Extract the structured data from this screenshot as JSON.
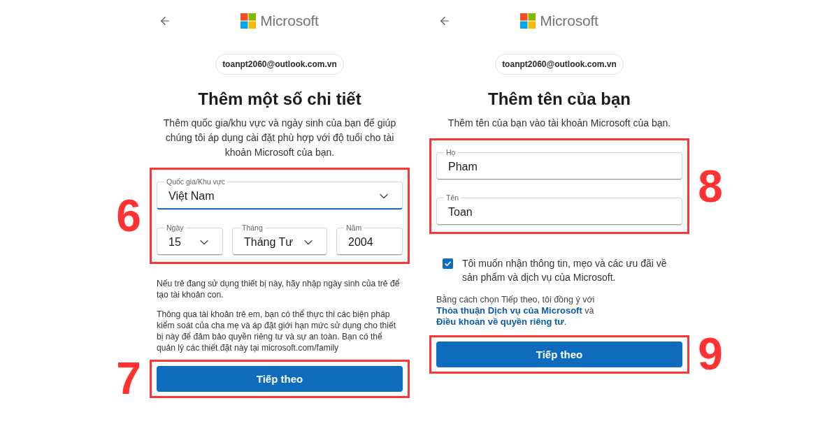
{
  "screens": [
    {
      "brand": "Microsoft",
      "account": "toanpt2060@outlook.com.vn",
      "title": "Thêm một số chi tiết",
      "description": "Thêm quốc gia/khu vực và ngày sinh của bạn để giúp chúng tôi áp dụng cài đặt phù hợp với độ tuổi cho tài khoản Microsoft của bạn.",
      "blocks": [
        {
          "kind": "fields",
          "step": "6",
          "rows": [
            [
              {
                "kind": "select",
                "label": "Quốc gia/Khu vực",
                "value": "Việt Nam",
                "focused": true
              }
            ],
            [
              {
                "kind": "select",
                "label": "Ngày",
                "value": "15",
                "focused": false
              },
              {
                "kind": "select",
                "label": "Tháng",
                "value": "Tháng Tư",
                "focused": false
              },
              {
                "kind": "text",
                "label": "Năm",
                "value": "2004",
                "focused": false
              }
            ]
          ]
        },
        {
          "kind": "paragraph",
          "text": "Nếu trẻ đang sử dụng thiết bị này, hãy nhập ngày sinh của trẻ để tạo tài khoản con."
        },
        {
          "kind": "paragraph",
          "text": "Thông qua tài khoản trẻ em, bạn có thể thực thi các biện pháp kiểm soát của cha mẹ và áp đặt giới hạn mức sử dụng cho thiết bị này để đảm bảo quyền riêng tư và sự an toàn. Bạn có thể quản lý các thiết đặt này tại microsoft.com/family"
        },
        {
          "kind": "button",
          "label": "Tiếp theo",
          "step": "7"
        }
      ]
    },
    {
      "brand": "Microsoft",
      "account": "toanpt2060@outlook.com.vn",
      "title": "Thêm tên của bạn",
      "description": "Thêm tên của bạn vào tài khoản Microsoft của bạn.",
      "blocks": [
        {
          "kind": "fields",
          "step": "8",
          "rows": [
            [
              {
                "kind": "text",
                "label": "Họ",
                "value": "Pham",
                "focused": false
              }
            ],
            [
              {
                "kind": "text",
                "label": "Tên",
                "value": "Toan",
                "focused": false
              }
            ]
          ]
        },
        {
          "kind": "checkbox",
          "checked": true,
          "text": "Tôi muốn nhận thông tin, mẹo và các ưu đãi về sản phẩm và dịch vụ của Microsoft."
        },
        {
          "kind": "legal",
          "parts": [
            {
              "kind": "text",
              "text": "Bằng cách chọn Tiếp theo, tôi đồng ý với "
            },
            {
              "kind": "link",
              "text": "Thỏa thuận Dịch vụ của Microsoft"
            },
            {
              "kind": "text",
              "text": " và "
            },
            {
              "kind": "link",
              "text": "Điều khoản về quyền riêng tư"
            },
            {
              "kind": "text",
              "text": "."
            }
          ]
        },
        {
          "kind": "button",
          "label": "Tiếp theo",
          "step": "9"
        }
      ]
    }
  ]
}
